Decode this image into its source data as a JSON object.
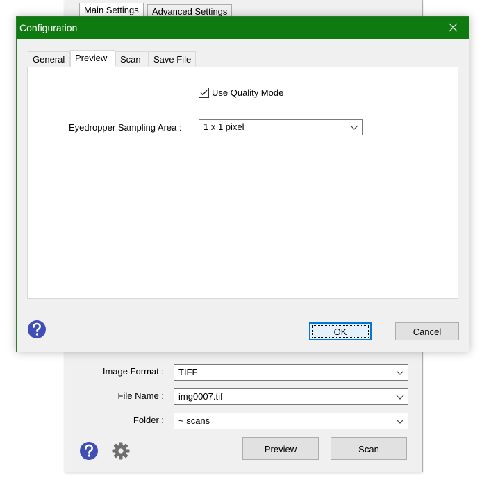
{
  "main_window": {
    "tabs": [
      {
        "label": "Main Settings",
        "active": true
      },
      {
        "label": "Advanced Settings",
        "active": false
      }
    ],
    "fields": {
      "image_format": {
        "label": "Image Format :",
        "value": "TIFF"
      },
      "file_name": {
        "label": "File Name :",
        "value": "img0007.tif"
      },
      "folder": {
        "label": "Folder :",
        "value": "~ scans"
      }
    },
    "buttons": {
      "preview": "Preview",
      "scan": "Scan"
    },
    "icons": {
      "help": "help-icon",
      "settings": "gear-icon"
    }
  },
  "dialog": {
    "title": "Configuration",
    "tabs": [
      {
        "label": "General",
        "active": false
      },
      {
        "label": "Preview",
        "active": true
      },
      {
        "label": "Scan",
        "active": false
      },
      {
        "label": "Save File",
        "active": false
      }
    ],
    "quality_mode": {
      "label": "Use Quality Mode",
      "checked": true
    },
    "eyedropper": {
      "label": "Eyedropper Sampling Area :",
      "value": "1 x 1 pixel"
    },
    "buttons": {
      "ok": "OK",
      "cancel": "Cancel"
    }
  },
  "colors": {
    "title_bar": "#0f7a0f",
    "help_icon": "#3f4fb6",
    "focus_border": "#0078d7"
  }
}
